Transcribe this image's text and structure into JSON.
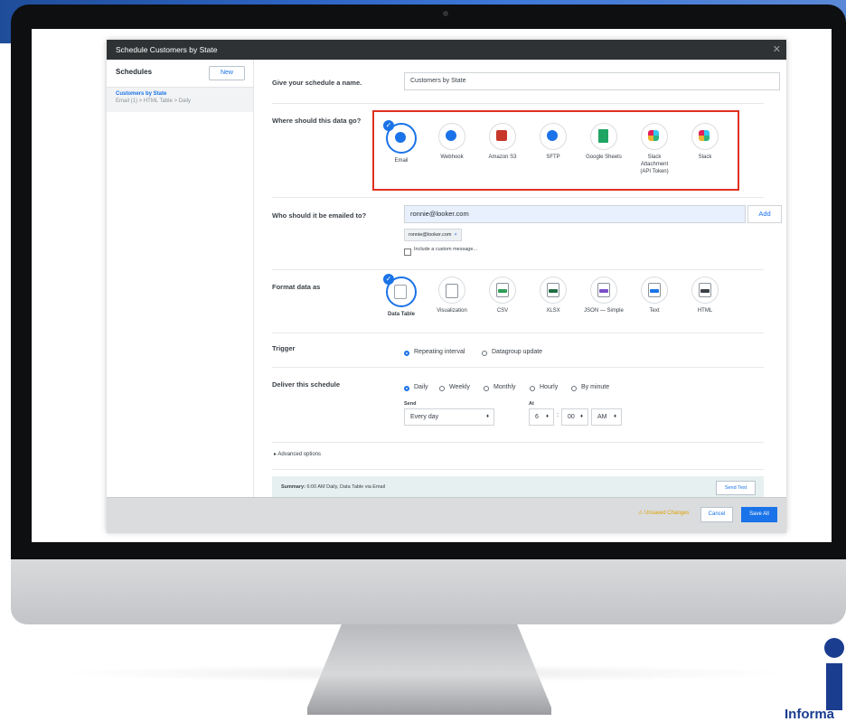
{
  "dialog": {
    "title": "Schedule Customers by State",
    "close_glyph": "✕"
  },
  "sidebar": {
    "title": "Schedules",
    "new_label": "New",
    "items": [
      {
        "name": "Customers by State",
        "details": "Email (1) > HTML Table > Daily"
      }
    ]
  },
  "name_row": {
    "label": "Give your schedule a name.",
    "value": "Customers by State"
  },
  "destination": {
    "label": "Where should this data go?",
    "options": [
      {
        "label": "Email",
        "icon": "email-icon",
        "color": "#1a73e8",
        "selected": true
      },
      {
        "label": "Webhook",
        "icon": "webhook-icon",
        "color": "#1a73e8"
      },
      {
        "label": "Amazon S3",
        "icon": "amazon-s3-icon",
        "color": "#c7382a"
      },
      {
        "label": "SFTP",
        "icon": "sftp-icon",
        "color": "#1a73e8"
      },
      {
        "label": "Google Sheets",
        "icon": "google-sheets-icon",
        "color": "#1fa463"
      },
      {
        "label": "Slack\nAttachment\n(API Token)",
        "icon": "slack-icon",
        "color": "#4a154b"
      },
      {
        "label": "Slack",
        "icon": "slack-icon",
        "color": "#4a154b"
      }
    ]
  },
  "recipients": {
    "label": "Who should it be emailed to?",
    "input_value": "ronnie@looker.com",
    "add_label": "Add",
    "chip": "ronnie@looker.com",
    "custom_message": "Include a custom message..."
  },
  "format": {
    "label": "Format data as",
    "options": [
      {
        "label": "Data Table",
        "tag_color": "#9aa3ab",
        "selected": true
      },
      {
        "label": "Visualization",
        "tag_color": "#9aa3ab"
      },
      {
        "label": "CSV",
        "tag_color": "#2e9e57"
      },
      {
        "label": "XLSX",
        "tag_color": "#1f6e43"
      },
      {
        "label": "JSON — Simple",
        "tag_color": "#7b4fc9"
      },
      {
        "label": "Text",
        "tag_color": "#1a73e8"
      },
      {
        "label": "HTML",
        "tag_color": "#3a4047"
      }
    ]
  },
  "trigger": {
    "label": "Trigger",
    "options": [
      "Repeating interval",
      "Datagroup update"
    ],
    "selected": "Repeating interval"
  },
  "deliver": {
    "label": "Deliver this schedule",
    "options": [
      "Daily",
      "Weekly",
      "Monthly",
      "Hourly",
      "By minute"
    ],
    "selected": "Daily",
    "send_label": "Send",
    "send_value": "Every day",
    "at_label": "At",
    "hour": "6",
    "separator": ":",
    "minute": "00",
    "ampm": "AM"
  },
  "advanced": {
    "label": "Advanced options"
  },
  "summary": {
    "prefix": "Summary:",
    "text": "6:00 AM Daily, Data Table via Email",
    "send_test": "Send Test"
  },
  "footer": {
    "unsaved": "⚠ Unsaved Changes",
    "cancel": "Cancel",
    "save_all": "Save All"
  },
  "brand": {
    "word": "Informa"
  }
}
